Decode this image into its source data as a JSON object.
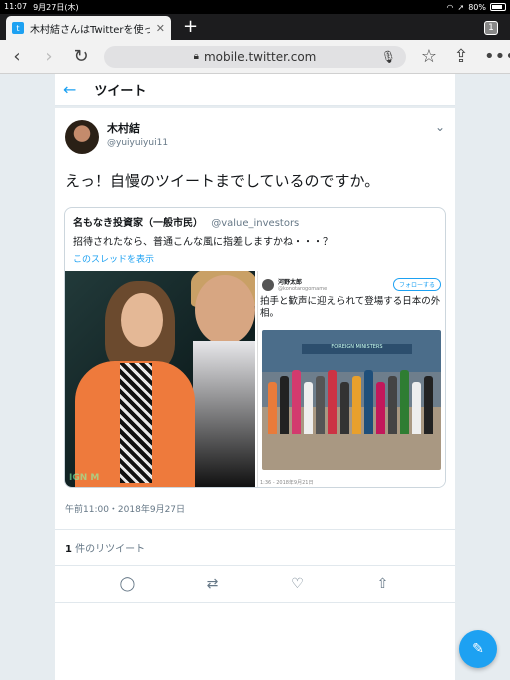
{
  "statusbar": {
    "time": "11:07",
    "date": "9月27日(木)",
    "battery": "80%"
  },
  "browser": {
    "tab_title": "木村結さんはTwitterを使っ",
    "tab_count": "1",
    "url": "mobile.twitter.com"
  },
  "header": {
    "title": "ツイート"
  },
  "tweet": {
    "display_name": "木村結",
    "handle": "@yuiyuiyui11",
    "text": "えっ！自慢のツイートまでしているのですか。",
    "timestamp": "午前11:00・2018年9月27日",
    "retweet_count": "1",
    "retweet_label": " 件のリツイート"
  },
  "quote": {
    "display_name": "名もなき投資家（一般市民）",
    "handle": "@value_investors",
    "text": "招待されたなら、普通こんな風に指差しますかね・・・？",
    "thread_link": "このスレッドを表示",
    "photo1_watermark": "IGN M",
    "screenshot": {
      "name": "河野太郎",
      "handle": "@konotarogomame",
      "follow": "フォローする",
      "text": "拍手と歓声に迎えられて登場する日本の外相。",
      "banner": "FOREIGN MINISTERS",
      "caption": "1:36 - 2018年9月21日"
    }
  },
  "colors": {
    "accent": "#1da1f2"
  }
}
